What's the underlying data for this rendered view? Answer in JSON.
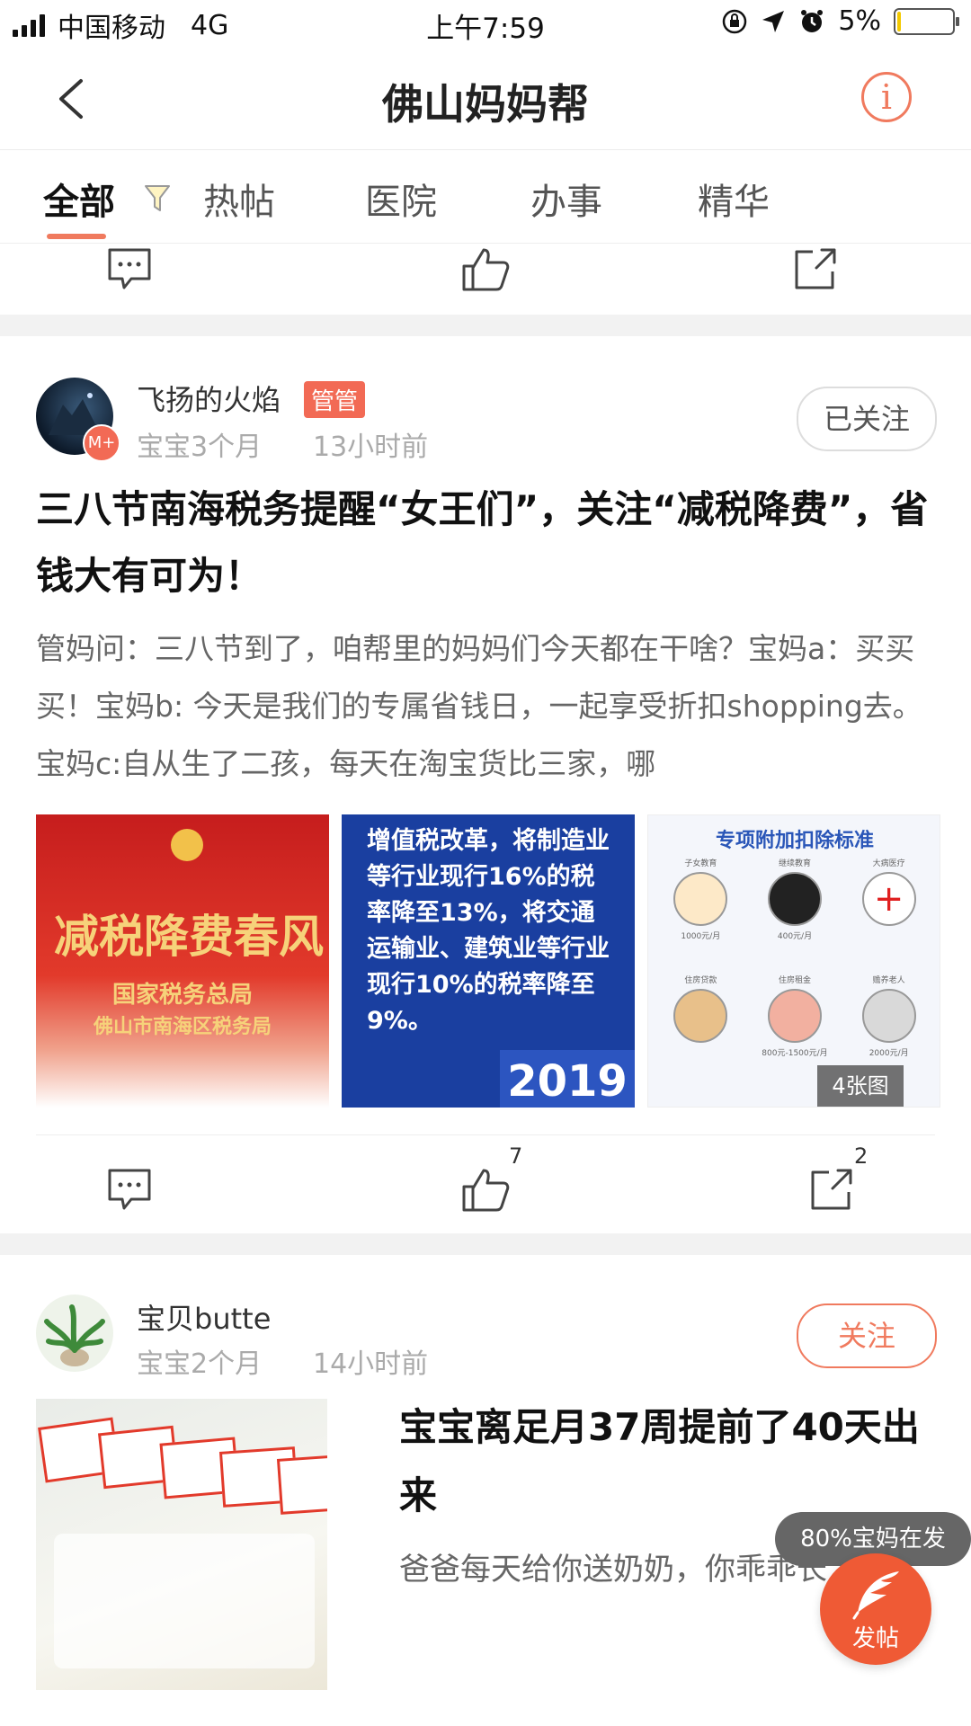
{
  "status_bar": {
    "carrier": "中国移动",
    "network": "4G",
    "time": "上午7:59",
    "battery": "5%",
    "battery_level": 0.05
  },
  "nav": {
    "back_icon": "chevron-left-icon",
    "title": "佛山妈妈帮",
    "info_icon": "info-icon",
    "info_glyph": "i",
    "accent_color": "#f07a5e"
  },
  "tabs": [
    {
      "label": "全部",
      "active": true
    },
    {
      "label": "热帖"
    },
    {
      "label": "医院"
    },
    {
      "label": "办事"
    },
    {
      "label": "精华"
    }
  ],
  "post1": {
    "username": "飞扬的火焰",
    "badge": "管管",
    "baby_age": "宝宝3个月",
    "time_ago": "13小时前",
    "follow_label": "已关注",
    "title": "三八节南海税务提醒“女王们”，关注“减税降费”，省钱大有可为！",
    "body": "管妈问：三八节到了，咱帮里的妈妈们今天都在干啥？宝妈a：买买买！宝妈b: 今天是我们的专属省钱日，一起享受折扣shopping去。宝妈c:自从生了二孩，每天在淘宝货比三家，哪",
    "images": {
      "img1": {
        "line1": "减税降费春风",
        "line2": "国家税务总局",
        "line3": "佛山市南海区税务局"
      },
      "img2": {
        "text": "增值税改革，将制造业等行业现行16%的税率降至13%，将交通运输业、建筑业等行业现行10%的税率降至9%。",
        "year": "2019"
      },
      "img3": {
        "title": "专项附加扣除标准",
        "labels": [
          "子女教育",
          "继续教育",
          "大病医疗",
          "住房贷款",
          "住房租金",
          "赡养老人"
        ],
        "amounts": [
          "1000元/月",
          "400元/月",
          "800元-1500元/月",
          "2000元/月"
        ]
      },
      "count_label": "4张图"
    },
    "like_count": "7",
    "share_count": "2"
  },
  "post2": {
    "username": "宝贝butte",
    "baby_age": "宝宝2个月",
    "time_ago": "14小时前",
    "follow_label": "关注",
    "title": "宝宝离足月37周提前了40天出来",
    "body": "爸爸每天给你送奶奶，你乖乖长大哦！"
  },
  "fab": {
    "tip": "80%宝妈在发",
    "label": "发帖",
    "color": "#ef5a35"
  }
}
